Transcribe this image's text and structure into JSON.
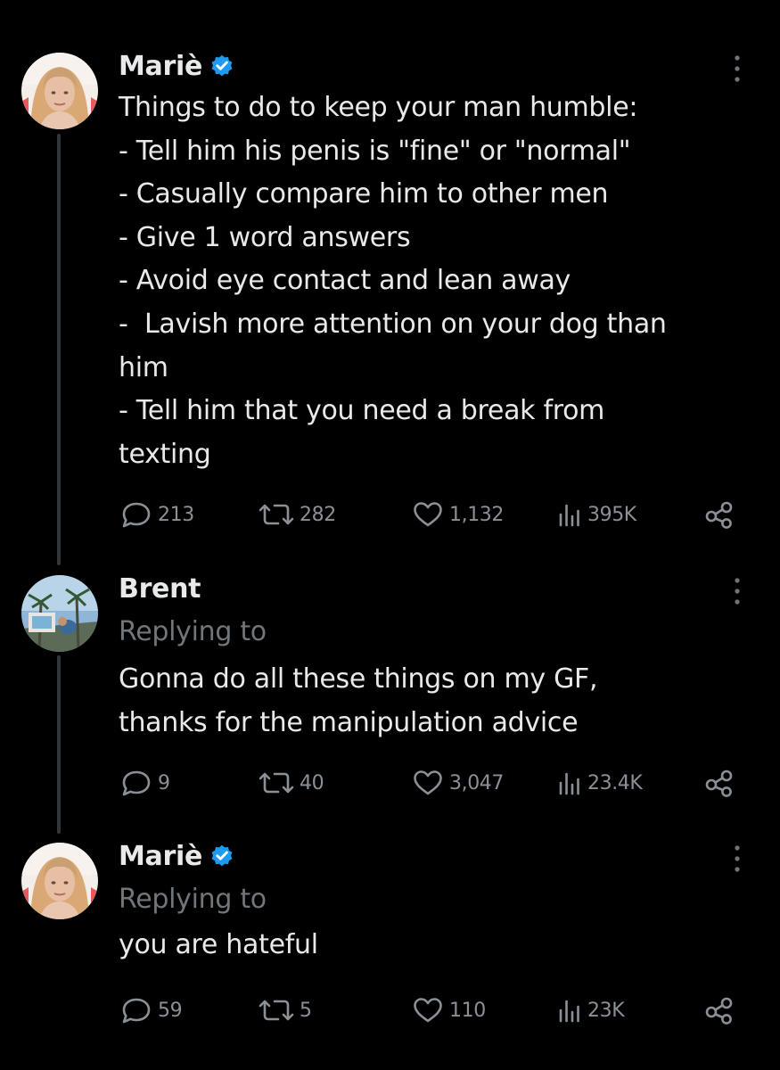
{
  "colors": {
    "background": "#000000",
    "text_primary": "#e7e9ea",
    "text_secondary": "#71767b",
    "verified_badge": "#1d9bf0",
    "thread_line": "#333639"
  },
  "icons": {
    "reply": "speech-bubble-icon",
    "repost": "repost-arrows-icon",
    "like": "heart-icon",
    "views": "bar-chart-icon",
    "share": "share-nodes-icon",
    "more": "vertical-ellipsis-icon",
    "verified": "verified-badge-icon"
  },
  "tweets": [
    {
      "author": "Mariè",
      "verified": true,
      "replying_to": "",
      "lines": [
        "Things to do to keep your man humble:",
        "- Tell him his penis is \"fine\" or \"normal\"",
        "- Casually compare him to other men",
        "- Give 1 word answers",
        "- Avoid eye contact and lean away",
        "-  Lavish more attention on your dog than",
        "him",
        "- Tell him that you need a break from",
        "texting"
      ],
      "stats": {
        "replies": "213",
        "reposts": "282",
        "likes": "1,132",
        "views": "395K"
      }
    },
    {
      "author": "Brent",
      "verified": false,
      "replying_to": "Replying to",
      "lines": [
        "Gonna do all these things on my GF,",
        "thanks for the manipulation advice"
      ],
      "stats": {
        "replies": "9",
        "reposts": "40",
        "likes": "3,047",
        "views": "23.4K"
      }
    },
    {
      "author": "Mariè",
      "verified": true,
      "replying_to": "Replying to",
      "lines": [
        "you are hateful"
      ],
      "stats": {
        "replies": "59",
        "reposts": "5",
        "likes": "110",
        "views": "23K"
      }
    }
  ]
}
